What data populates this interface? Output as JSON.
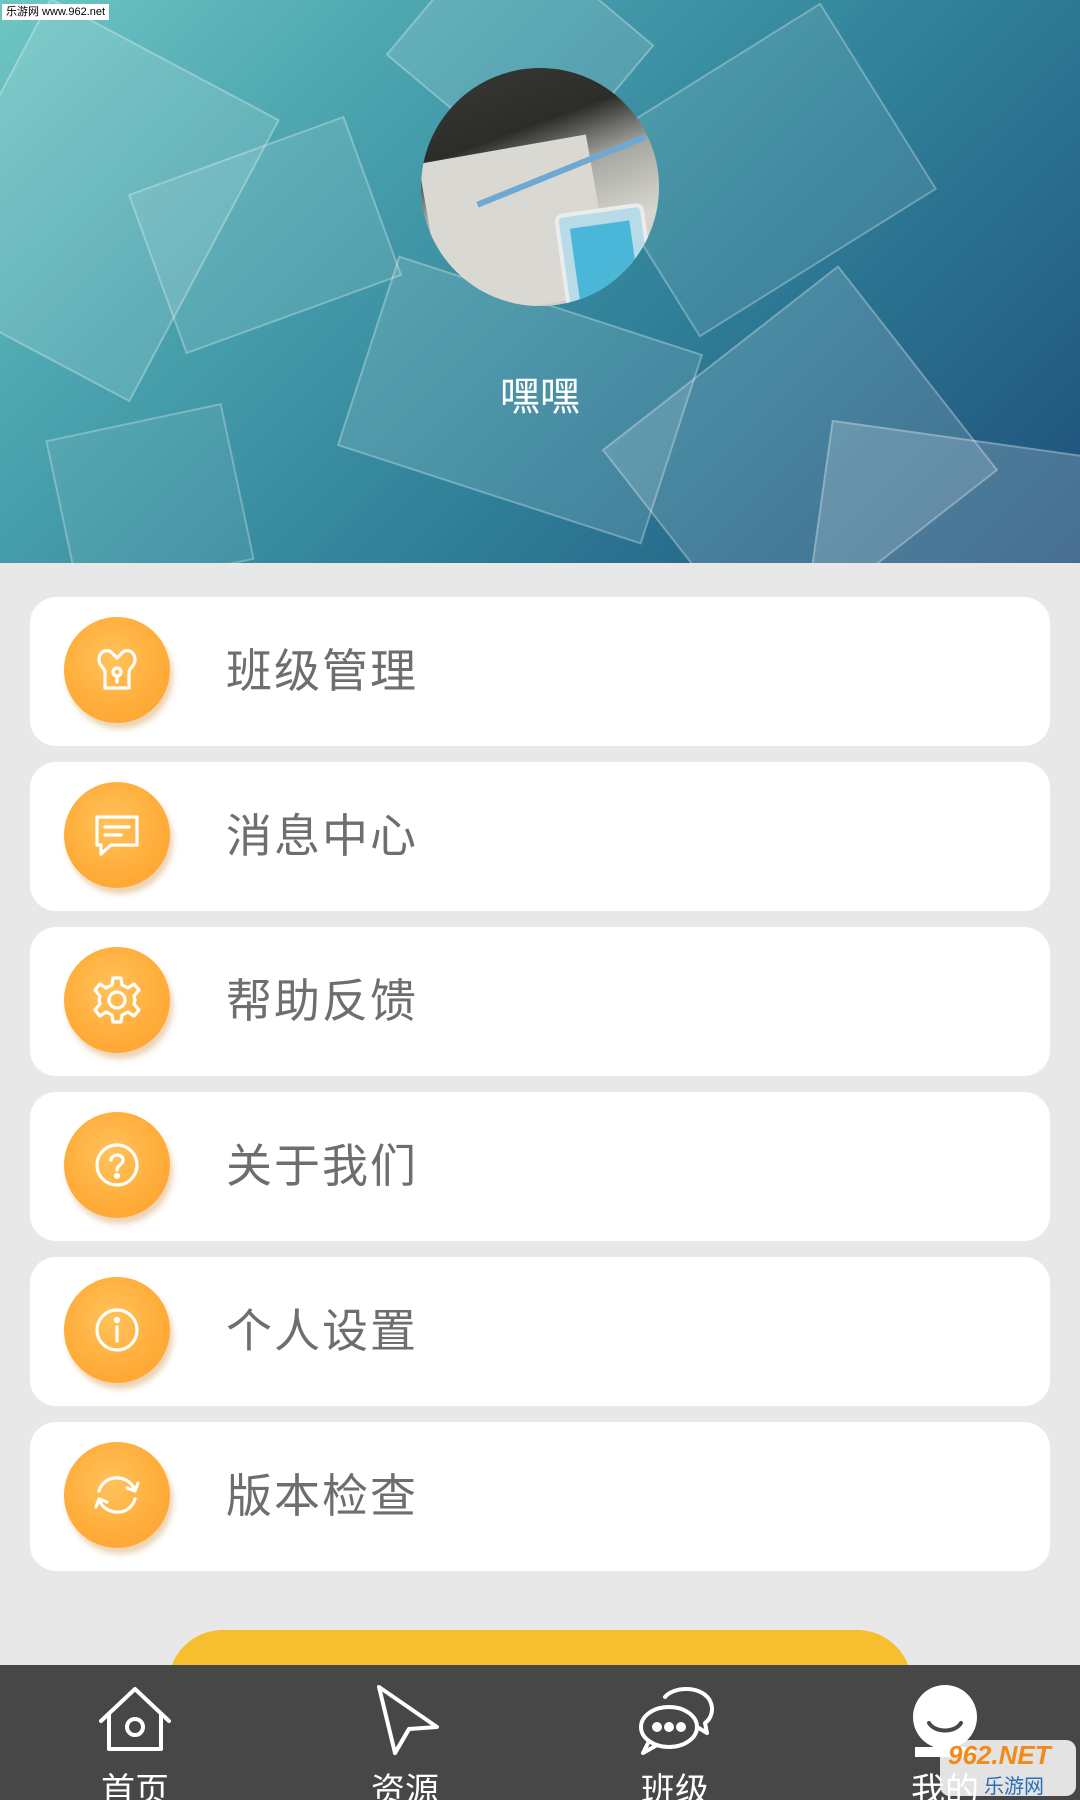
{
  "watermark": {
    "top_left": "乐游网 www.962.net",
    "bottom_right_logo": "962.NET",
    "bottom_right_sub": "乐游网"
  },
  "profile": {
    "avatar": "user-photo-avatar",
    "username": "嘿嘿"
  },
  "menu": {
    "items": [
      {
        "label": "班级管理",
        "icon": "class-lock-icon"
      },
      {
        "label": "消息中心",
        "icon": "message-icon"
      },
      {
        "label": "帮助反馈",
        "icon": "gear-icon"
      },
      {
        "label": "关于我们",
        "icon": "question-icon"
      },
      {
        "label": "个人设置",
        "icon": "info-icon"
      },
      {
        "label": "版本检查",
        "icon": "refresh-icon"
      }
    ]
  },
  "tabbar": {
    "items": [
      {
        "label": "首页",
        "icon": "home-icon"
      },
      {
        "label": "资源",
        "icon": "cursor-icon"
      },
      {
        "label": "班级",
        "icon": "chat-bubbles-icon"
      },
      {
        "label": "我的",
        "icon": "user-icon",
        "active": true
      }
    ]
  },
  "colors": {
    "accent_orange": "#ffae3b",
    "logout_yellow": "#f5bf2f",
    "tabbar_bg": "#474747",
    "label_gray": "#6e6e6e"
  }
}
